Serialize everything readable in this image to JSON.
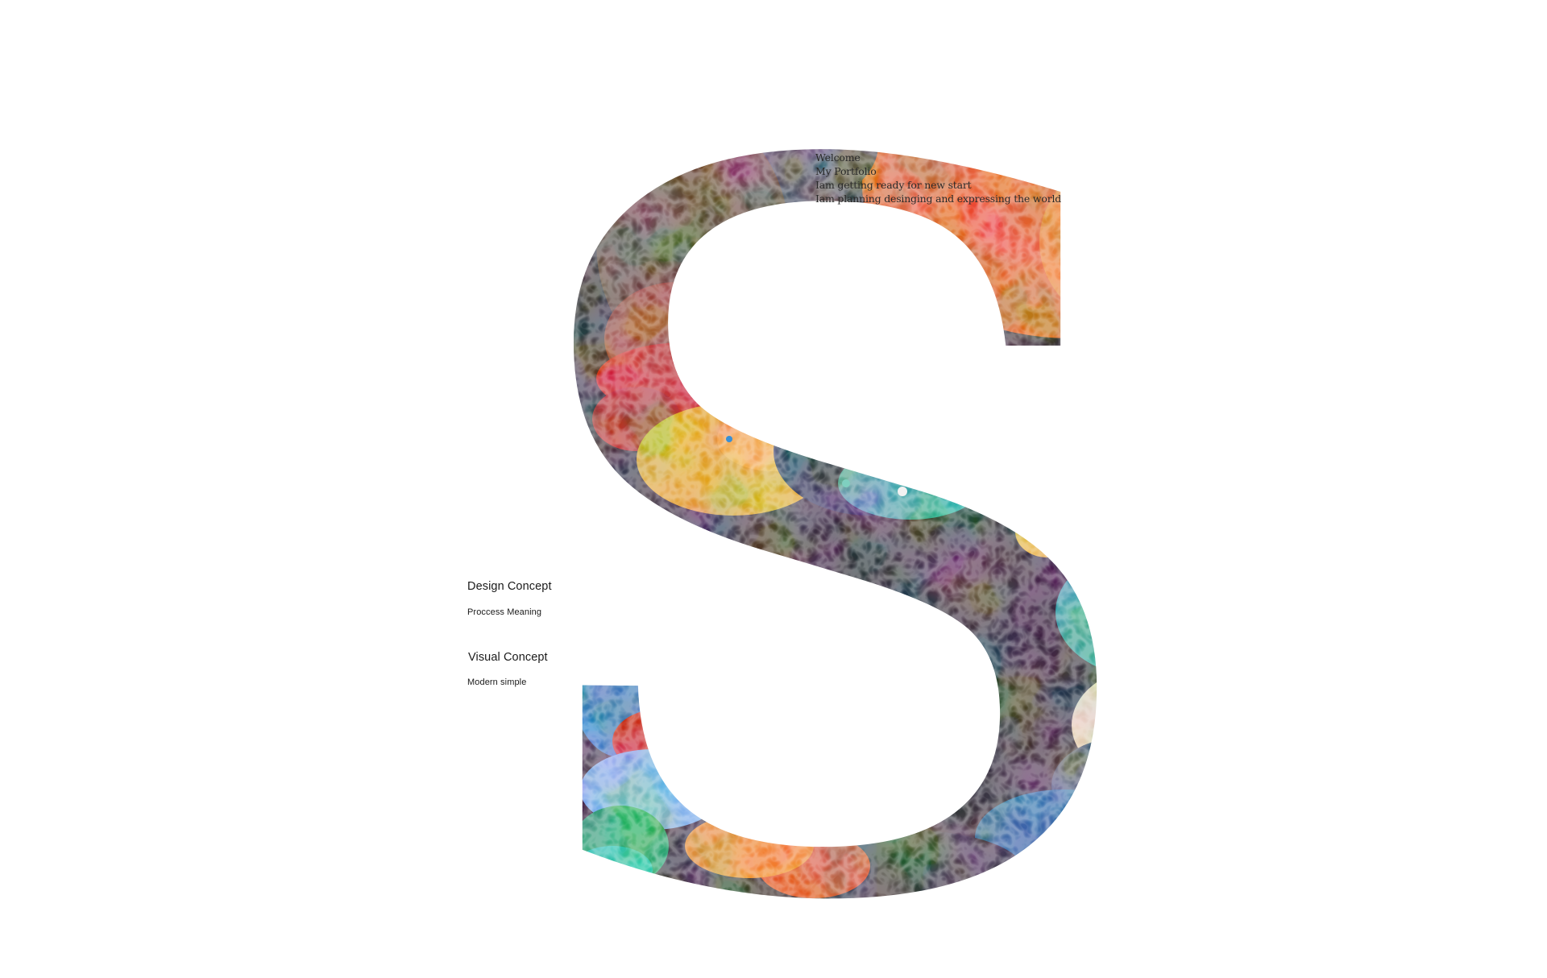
{
  "intro_lines": [
    "Welcome",
    "My Portfolio",
    "Iam getting ready for new start",
    "Iam planning desinging and expressing the world"
  ],
  "concepts": [
    {
      "title": "Design Concept",
      "subtitle": "Proccess Meaning"
    },
    {
      "title": "Visual Concept",
      "subtitle": "Modern simple"
    }
  ],
  "palette": {
    "background": "#ffffff",
    "orange": "#e8561c",
    "red": "#c2241c",
    "ochre": "#e0a31f",
    "teal": "#2aa0a0",
    "blue": "#3a8fd6",
    "brown": "#7a3d14",
    "navy": "#1c2a4a",
    "cream": "#f2d3a6",
    "green": "#1fa06a"
  }
}
